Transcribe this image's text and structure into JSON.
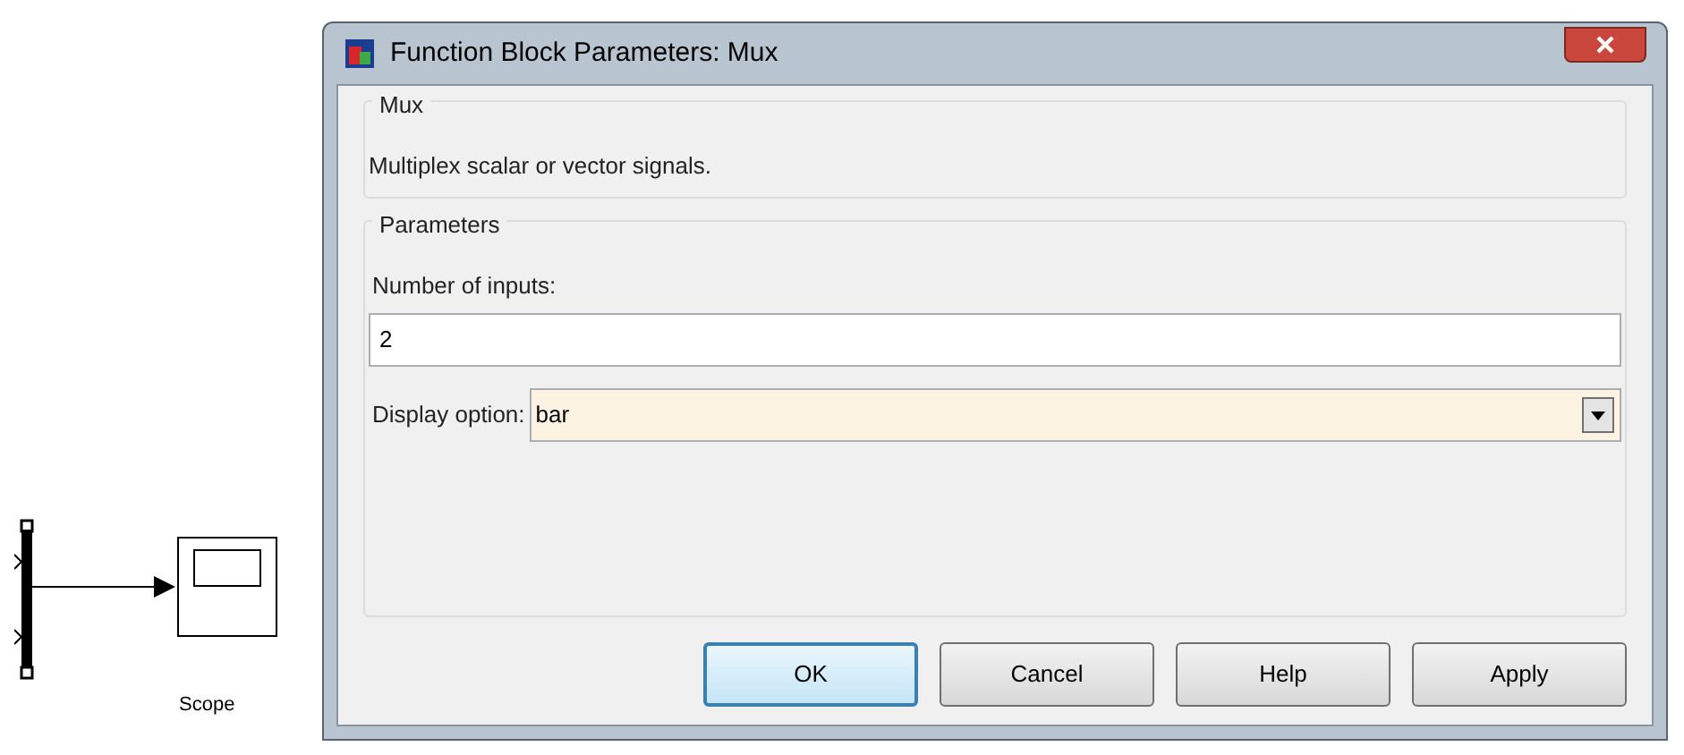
{
  "diagram": {
    "blocks": [
      {
        "kind": "mux"
      },
      {
        "kind": "scope",
        "label": "Scope"
      }
    ]
  },
  "window": {
    "title": "Function Block Parameters: Mux"
  },
  "description_group": {
    "title": "Mux",
    "text": "Multiplex scalar or vector signals."
  },
  "parameters_group": {
    "title": "Parameters",
    "fields": [
      {
        "kind": "text",
        "label": "Number of inputs:",
        "value": "2"
      },
      {
        "kind": "select",
        "label": "Display option:",
        "value": "bar"
      }
    ]
  },
  "buttons": [
    {
      "label": "OK",
      "default": true
    },
    {
      "label": "Cancel",
      "default": false
    },
    {
      "label": "Help",
      "default": false
    },
    {
      "label": "Apply",
      "default": false
    }
  ]
}
